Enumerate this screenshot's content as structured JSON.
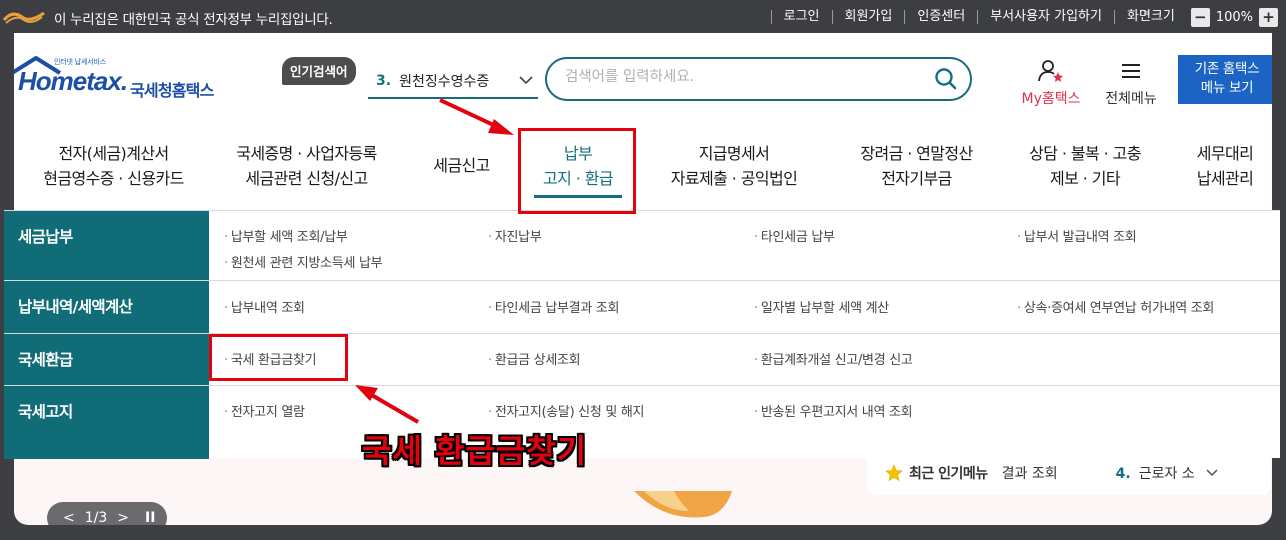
{
  "gov_bar": {
    "notice": "이 누리집은 대한민국 공식 전자정부 누리집입니다.",
    "links": [
      "로그인",
      "회원가입",
      "인증센터",
      "부서사용자 가입하기",
      "화면크기"
    ],
    "zoom_minus": "−",
    "zoom_value": "100%",
    "zoom_plus": "+"
  },
  "logo": {
    "tagline": "인터넷 납세서비스",
    "brand": "Hometax.",
    "brand_ko": "국세청홈택스"
  },
  "popular_search": {
    "badge": "인기검색어",
    "rank": "3.",
    "term": "원천징수영수증"
  },
  "search": {
    "placeholder": "검색어를 입력하세요."
  },
  "my_hometax": {
    "prefix": "My",
    "label": "홈택스"
  },
  "all_menu": {
    "label": "전체메뉴"
  },
  "old_home": {
    "line1": "기존 홈택스",
    "line2": "메뉴 보기"
  },
  "gnb": [
    {
      "line1": "전자(세금)계산서",
      "line2": "현금영수증 · 신용카드"
    },
    {
      "line1": "국세증명 · 사업자등록",
      "line2": "세금관련 신청/신고"
    },
    {
      "line1": "세금신고",
      "line2": ""
    },
    {
      "line1": "납부",
      "line2": "고지 · 환급"
    },
    {
      "line1": "지급명세서",
      "line2": "자료제출 · 공익법인"
    },
    {
      "line1": "장려금 · 연말정산",
      "line2": "전자기부금"
    },
    {
      "line1": "상담 · 불복 · 고충",
      "line2": "제보 · 기타"
    },
    {
      "line1": "세무대리",
      "line2": "납세관리"
    }
  ],
  "dropdown": [
    {
      "category": "세금납부",
      "links": [
        "납부할 세액 조회/납부",
        "자진납부",
        "타인세금 납부",
        "납부서 발급내역 조회",
        "원천세 관련 지방소득세 납부"
      ]
    },
    {
      "category": "납부내역/세액계산",
      "links": [
        "납부내역 조회",
        "타인세금 납부결과 조회",
        "일자별 납부할 세액 계산",
        "상속·증여세 연부연납 허가내역 조회"
      ]
    },
    {
      "category": "국세환급",
      "links": [
        "국세 환급금찾기",
        "환급금 상세조회",
        "환급계좌개설 신고/변경 신고"
      ]
    },
    {
      "category": "국세고지",
      "links": [
        "전자고지 열람",
        "전자고지(송달) 신청 및 해지",
        "반송된 우편고지서 내역 조회"
      ]
    }
  ],
  "annotation": {
    "callout": "국세 환급금찾기"
  },
  "pager": {
    "prev": "<",
    "page": "1/3",
    "next": ">",
    "pause": "II"
  },
  "popular_menu": {
    "title": "최근 인기메뉴",
    "item1": "결과 조회",
    "item2_rank": "4.",
    "item2": "근로자 소"
  },
  "colors": {
    "teal": "#106c77",
    "red_annotation": "#e3000f",
    "brand_blue": "#1c4fa6"
  }
}
